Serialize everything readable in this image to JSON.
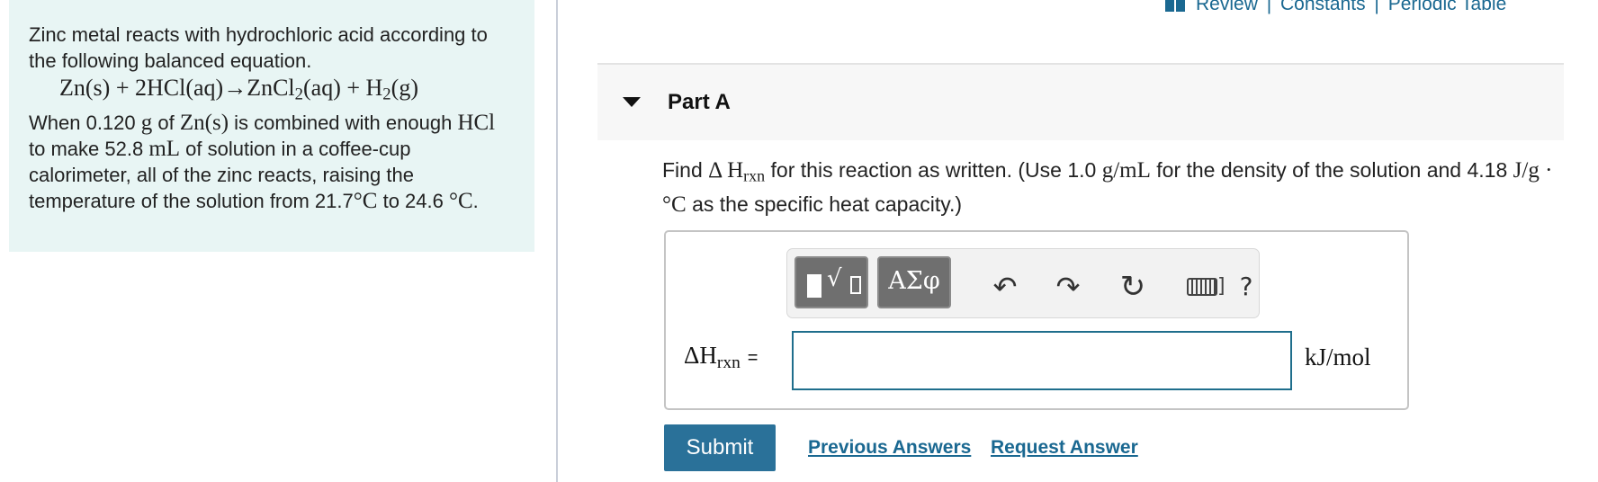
{
  "problem": {
    "intro": "Zinc metal reacts with hydrochloric acid according to the following balanced equation.",
    "equation": {
      "reactant1": "Zn(s) + 2HCl(aq)",
      "arrow": "→",
      "product1_main": "ZnCl",
      "product1_sub": "2",
      "product1_state": "(aq) + H",
      "product2_sub": "2",
      "product2_state": "(g)"
    },
    "text_1": "When 0.120",
    "unit_g": "g",
    "text_2": "of",
    "zn": "Zn(s)",
    "text_3": "is combined with enough",
    "hcl": "HCl",
    "text_4": "to make 52.8",
    "unit_ml": "mL",
    "text_5": "of solution in a coffee-cup calorimeter, all of the zinc reacts, raising the temperature of the solution from 21.7",
    "degc1": "°C",
    "text_6": "to 24.6",
    "degc2": "°C",
    "text_end": "."
  },
  "top_links": {
    "review": "Review",
    "sep": "|",
    "constants": "Constants",
    "periodic_table": "Periodic Table"
  },
  "part": {
    "title": "Part A"
  },
  "question": {
    "text_1": "Find",
    "delta_h": "Δ H",
    "rxn": "rxn",
    "text_2": "for this reaction as written. (Use 1.0",
    "density_unit": "g/mL",
    "text_3": "for the density of the solution and 4.18",
    "heat_unit": "J/g · °C",
    "text_4": "as the specific heat capacity.)"
  },
  "toolbar": {
    "greek_label": "ΑΣφ",
    "radical_label": "√",
    "undo_glyph": "↶",
    "redo_glyph": "↷",
    "reset_glyph": "↻",
    "help_label": "?"
  },
  "answer": {
    "lhs_delta": "ΔH",
    "lhs_sub": "rxn",
    "lhs_equals": "=",
    "input_value": "",
    "unit": "kJ/mol"
  },
  "actions": {
    "submit": "Submit",
    "previous_answers": "Previous Answers",
    "request_answer": "Request Answer"
  }
}
